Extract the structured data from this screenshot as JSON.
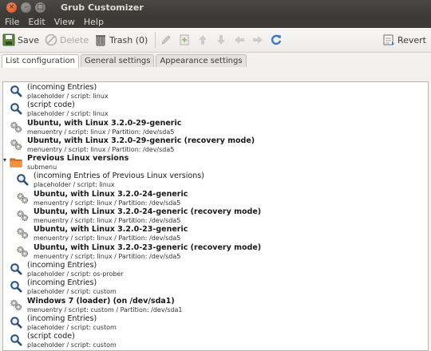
{
  "window": {
    "title": "Grub Customizer"
  },
  "menu": {
    "items": [
      "File",
      "Edit",
      "View",
      "Help"
    ]
  },
  "toolbar": {
    "save": "Save",
    "delete": "Delete",
    "trash": "Trash (0)",
    "revert": "Revert"
  },
  "tabs": [
    "List configuration",
    "General settings",
    "Appearance settings"
  ],
  "entries": [
    {
      "name": "(incoming Entries)",
      "sub": "placeholder / script: linux",
      "icon": "magnifier-icon",
      "bold": false,
      "level": 0
    },
    {
      "name": "(script code)",
      "sub": "placeholder / script: linux",
      "icon": "magnifier-icon",
      "bold": false,
      "level": 0
    },
    {
      "name": "Ubuntu, with Linux 3.2.0-29-generic",
      "sub": "menuentry / script: linux / Partition: /dev/sda5",
      "icon": "gears-icon",
      "bold": true,
      "level": 0
    },
    {
      "name": "Ubuntu, with Linux 3.2.0-29-generic (recovery mode)",
      "sub": "menuentry / script: linux / Partition: /dev/sda5",
      "icon": "gears-icon",
      "bold": true,
      "level": 0
    },
    {
      "name": "Previous Linux versions",
      "sub": "submenu",
      "icon": "folder-icon",
      "bold": true,
      "level": 0,
      "expander": "▾"
    },
    {
      "name": "(incoming Entries of Previous Linux versions)",
      "sub": "placeholder / script: linux",
      "icon": "magnifier-icon",
      "bold": false,
      "level": 1
    },
    {
      "name": "Ubuntu, with Linux 3.2.0-24-generic",
      "sub": "menuentry / script: linux / Partition: /dev/sda5",
      "icon": "gears-icon",
      "bold": true,
      "level": 1
    },
    {
      "name": "Ubuntu, with Linux 3.2.0-24-generic (recovery mode)",
      "sub": "menuentry / script: linux / Partition: /dev/sda5",
      "icon": "gears-icon",
      "bold": true,
      "level": 1
    },
    {
      "name": "Ubuntu, with Linux 3.2.0-23-generic",
      "sub": "menuentry / script: linux / Partition: /dev/sda5",
      "icon": "gears-icon",
      "bold": true,
      "level": 1
    },
    {
      "name": "Ubuntu, with Linux 3.2.0-23-generic (recovery mode)",
      "sub": "menuentry / script: linux / Partition: /dev/sda5",
      "icon": "gears-icon",
      "bold": true,
      "level": 1
    },
    {
      "name": "(incoming Entries)",
      "sub": "placeholder / script: os-prober",
      "icon": "magnifier-icon",
      "bold": false,
      "level": 0
    },
    {
      "name": "(incoming Entries)",
      "sub": "placeholder / script: custom",
      "icon": "magnifier-icon",
      "bold": false,
      "level": 0
    },
    {
      "name": "Windows 7 (loader) (on /dev/sda1)",
      "sub": "menuentry / script: custom / Partition: /dev/sda1",
      "icon": "gears-icon",
      "bold": true,
      "level": 0
    },
    {
      "name": "(incoming Entries)",
      "sub": "placeholder / script: custom",
      "icon": "magnifier-icon",
      "bold": false,
      "level": 0
    },
    {
      "name": "(script code)",
      "sub": "placeholder / script: custom",
      "icon": "magnifier-icon",
      "bold": false,
      "level": 0
    }
  ]
}
